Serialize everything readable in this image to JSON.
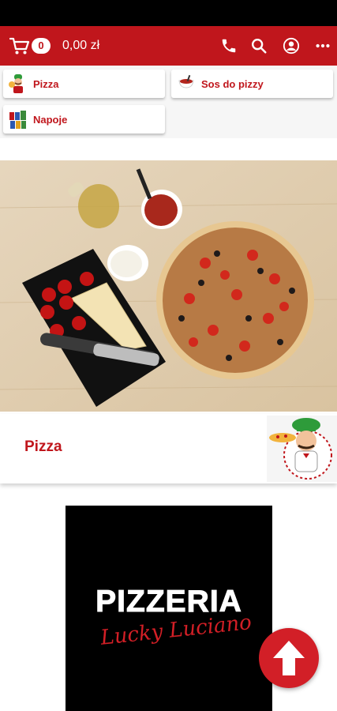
{
  "colors": {
    "brand": "#c0161c",
    "scroll_button": "#d21f27"
  },
  "header": {
    "cart_count": "0",
    "cart_total": "0,00 zł",
    "icons": [
      "cart-icon",
      "phone-icon",
      "search-icon",
      "account-icon",
      "more-icon"
    ]
  },
  "categories": [
    {
      "label": "Pizza",
      "icon": "pizza-chef-icon"
    },
    {
      "label": "Sos do pizzy",
      "icon": "sauce-icon"
    },
    {
      "label": "Napoje",
      "icon": "drinks-icon"
    }
  ],
  "section": {
    "title": "Pizza"
  },
  "logo": {
    "title": "PIZZERIA",
    "script": "Lucky Luciano"
  }
}
